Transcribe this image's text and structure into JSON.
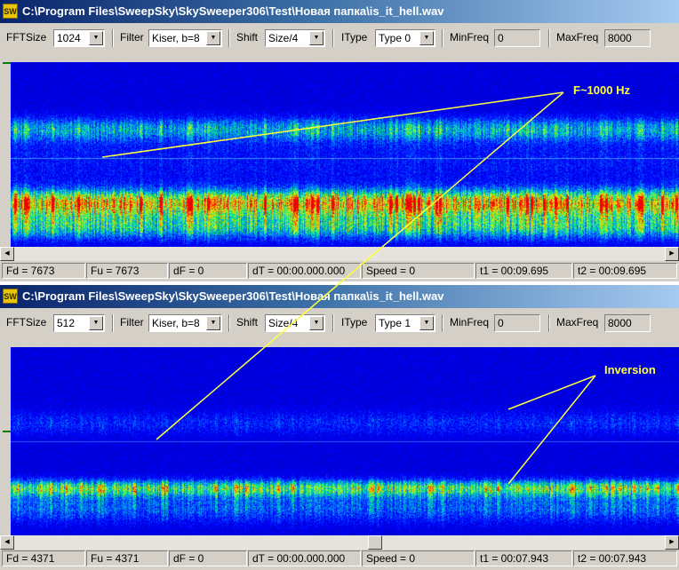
{
  "windows": [
    {
      "title": "C:\\Program Files\\SweepSky\\SkySweeper306\\Test\\Новая папка\\is_it_hell.wav",
      "app_icon": "SW",
      "toolbar": {
        "fftsize_label": "FFTSize",
        "fftsize_value": "1024",
        "filter_label": "Filter",
        "filter_value": "Kiser, b=8",
        "shift_label": "Shift",
        "shift_value": "Size/4",
        "itype_label": "IType",
        "itype_value": "Type 0",
        "minfreq_label": "MinFreq",
        "minfreq_value": "0",
        "maxfreq_label": "MaxFreq",
        "maxfreq_value": "8000"
      },
      "annotation": "F~1000 Hz",
      "status": [
        "Fd = 7673",
        "Fu = 7673",
        "dF = 0",
        "dT = 00:00.000.000",
        "Speed = 0",
        "t1 = 00:09.695",
        "t2 = 00:09.695"
      ]
    },
    {
      "title": "C:\\Program Files\\SweepSky\\SkySweeper306\\Test\\Новая папка\\is_it_hell.wav",
      "app_icon": "SW",
      "toolbar": {
        "fftsize_label": "FFTSize",
        "fftsize_value": "512",
        "filter_label": "Filter",
        "filter_value": "Kiser, b=8",
        "shift_label": "Shift",
        "shift_value": "Size/4",
        "itype_label": "IType",
        "itype_value": "Type 1",
        "minfreq_label": "MinFreq",
        "minfreq_value": "0",
        "maxfreq_label": "MaxFreq",
        "maxfreq_value": "8000"
      },
      "annotation": "Inversion",
      "status": [
        "Fd = 4371",
        "Fu = 4371",
        "dF = 0",
        "dT = 00:00.000.000",
        "Speed = 0",
        "t1 = 00:07.943",
        "t2 = 00:07.943"
      ]
    }
  ],
  "colors": {
    "spectrogram_bg": "#0000f0",
    "annotation": "#ffff40",
    "titlebar_start": "#0a246a",
    "titlebar_end": "#a6caf0",
    "cursor_line": "#40c0ff"
  },
  "icons": [
    "app-icon",
    "dropdown-arrow-icon",
    "scroll-left-icon",
    "scroll-right-icon"
  ]
}
